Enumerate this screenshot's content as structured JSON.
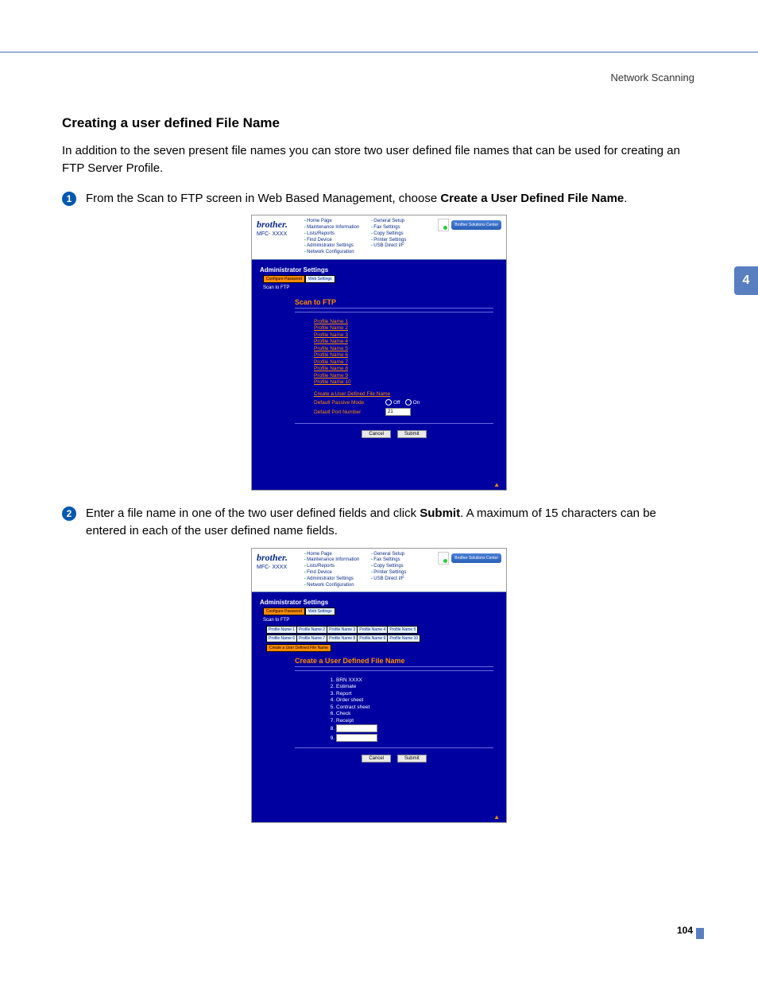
{
  "page": {
    "header_right": "Network Scanning",
    "chapter_tab": "4",
    "page_number": "104"
  },
  "heading": "Creating a user defined File Name",
  "intro": "In addition to the seven present file names you can store two user defined file names that can be used for creating an FTP Server Profile.",
  "steps": {
    "s1": {
      "pre": "From the Scan to FTP screen in Web Based Management, choose ",
      "bold": "Create a User Defined File Name",
      "post": "."
    },
    "s2": {
      "pre": "Enter a file name in one of the two user defined fields and click ",
      "bold": "Submit",
      "post": ". A maximum of 15 characters can be entered in each of the user defined name fields."
    }
  },
  "shot_common": {
    "brand": "brother.",
    "model": "MFC- XXXX",
    "nav_left": [
      "Home Page",
      "Maintenance Information",
      "Lists/Reports",
      "Find Device",
      "Administrator Settings",
      "Network Configuration"
    ],
    "nav_right": [
      "General Setup",
      "Fax Settings",
      "Copy Settings",
      "Printer Settings",
      "USB Direct I/F"
    ],
    "bsc": "Brother Solutions Center",
    "admin_heading": "Administrator Settings",
    "bc_configure": "Configure Password",
    "bc_web": "Web Settings",
    "bc_scan": "Scan to FTP",
    "cancel": "Cancel",
    "submit": "Submit"
  },
  "shot1": {
    "title": "Scan to FTP",
    "profiles": [
      "Profile Name 1",
      "Profile Name 2",
      "Profile Name 3",
      "Profile Name 4",
      "Profile Name 5",
      "Profile Name 6",
      "Profile Name 7",
      "Profile Name 8",
      "Profile Name 9",
      "Profile Name 10"
    ],
    "create_link": "Create a User Defined File Name",
    "passive_label": "Default Passive Mode",
    "passive_off": "Off",
    "passive_on": "On",
    "port_label": "Default Port Number",
    "port_value": "21"
  },
  "shot2": {
    "title": "Create a User Defined File Name",
    "tabs_row1": [
      "Profile Name 1",
      "Profile Name 2",
      "Profile Name 3",
      "Profile Name 4",
      "Profile Name 5"
    ],
    "tabs_row2": [
      "Profile Name 6",
      "Profile Name 7",
      "Profile Name 8",
      "Profile Name 9",
      "Profile Name 10"
    ],
    "create_tab": "Create a User Defined File Name",
    "names": [
      "BRN XXXX",
      "Estimate",
      "Report",
      "Order sheet",
      "Contract sheet",
      "Check",
      "Receipt"
    ]
  }
}
